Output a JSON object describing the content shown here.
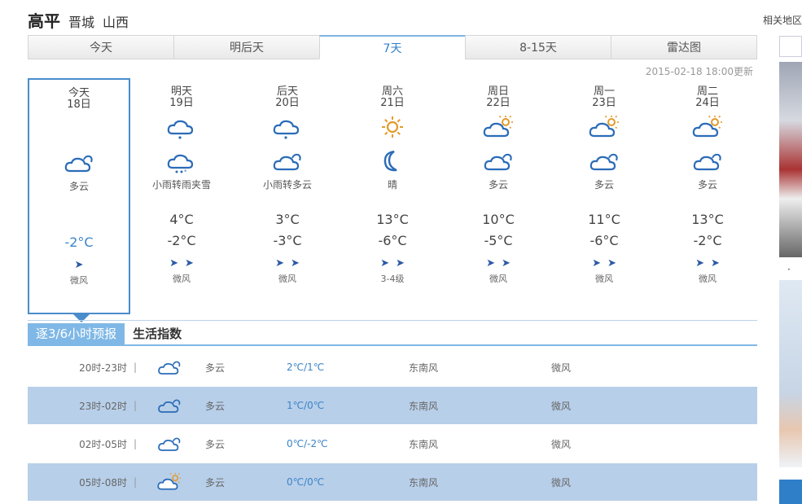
{
  "location": {
    "city": "高平",
    "parent_city": "晋城",
    "province": "山西"
  },
  "related_label": "相关地区",
  "tabs": [
    {
      "label": "今天"
    },
    {
      "label": "明后天"
    },
    {
      "label": "7天"
    },
    {
      "label": "8-15天"
    },
    {
      "label": "雷达图"
    }
  ],
  "active_tab": "7天",
  "update_time": "2015-02-18 18:00更新",
  "days": [
    {
      "name": "今天",
      "date": "18日",
      "icon_day": "",
      "icon_night": "cloudy-icon",
      "desc": "多云",
      "high": "",
      "low": "-2°C",
      "wind_level": "微风"
    },
    {
      "name": "明天",
      "date": "19日",
      "icon_day": "light-rain-icon",
      "icon_night": "sleet-icon",
      "desc": "小雨转雨夹雪",
      "high": "4°C",
      "low": "-2°C",
      "wind_level": "微风"
    },
    {
      "name": "后天",
      "date": "20日",
      "icon_day": "light-rain-icon",
      "icon_night": "cloudy-icon",
      "desc": "小雨转多云",
      "high": "3°C",
      "low": "-3°C",
      "wind_level": "微风"
    },
    {
      "name": "周六",
      "date": "21日",
      "icon_day": "sunny-icon",
      "icon_night": "moon-icon",
      "desc": "晴",
      "high": "13°C",
      "low": "-6°C",
      "wind_level": "3-4级"
    },
    {
      "name": "周日",
      "date": "22日",
      "icon_day": "partly-cloudy-icon",
      "icon_night": "cloudy-icon",
      "desc": "多云",
      "high": "10°C",
      "low": "-5°C",
      "wind_level": "微风"
    },
    {
      "name": "周一",
      "date": "23日",
      "icon_day": "partly-cloudy-icon",
      "icon_night": "cloudy-icon",
      "desc": "多云",
      "high": "11°C",
      "low": "-6°C",
      "wind_level": "微风"
    },
    {
      "name": "周二",
      "date": "24日",
      "icon_day": "partly-cloudy-icon",
      "icon_night": "cloudy-icon",
      "desc": "多云",
      "high": "13°C",
      "low": "-2°C",
      "wind_level": "微风"
    }
  ],
  "subtabs": [
    {
      "label": "逐3/6小时预报"
    },
    {
      "label": "生活指数"
    }
  ],
  "hourly": [
    {
      "time": "20时-23时",
      "separator": "|",
      "icon": "cloudy-icon",
      "weather": "多云",
      "temp": "2℃/1℃",
      "wind_dir": "东南风",
      "wind_level": "微风"
    },
    {
      "time": "23时-02时",
      "separator": "|",
      "icon": "cloudy-icon",
      "weather": "多云",
      "temp": "1℃/0℃",
      "wind_dir": "东南风",
      "wind_level": "微风"
    },
    {
      "time": "02时-05时",
      "separator": "|",
      "icon": "cloudy-icon",
      "weather": "多云",
      "temp": "0℃/-2℃",
      "wind_dir": "东南风",
      "wind_level": "微风"
    },
    {
      "time": "05时-08时",
      "separator": "|",
      "icon": "partly-cloudy-icon",
      "weather": "多云",
      "temp": "0℃/0℃",
      "wind_dir": "东南风",
      "wind_level": "微风"
    }
  ],
  "colors": {
    "accent": "#2f7fc8",
    "selected_border": "#4a8ccc",
    "row_alt": "#b8cfe9",
    "icon_blue": "#2b6cb8",
    "sun_orange": "#e39a2a"
  }
}
